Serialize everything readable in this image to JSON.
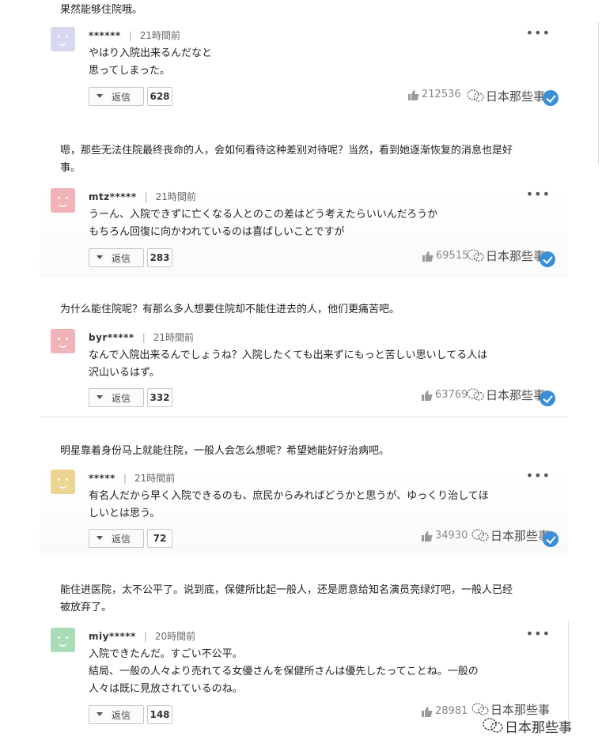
{
  "top_caption": "果然能够住院哦。",
  "watermark": "日本那些事",
  "reply_label": "返信",
  "comments": [
    {
      "caption": "",
      "user": "******",
      "time": "21時間前",
      "avatar_color": "#d6d9ef",
      "lines": [
        "やはり入院出来るんだなと",
        "思ってしまった。"
      ],
      "reply_count": "628",
      "likes": "212536"
    },
    {
      "caption_lines": [
        "嗯，那些无法住院最终丧命的人，会如何看待这种差别对待呢？当然，看到她逐渐恢复的消息也是好",
        "事。"
      ],
      "user": "mtz*****",
      "time": "21時間前",
      "avatar_color": "#f2b3b8",
      "lines": [
        "うーん、入院できずに亡くなる人とのこの差はどう考えたらいいんだろうか",
        "もちろん回復に向かわれているのは喜ばしいことですが"
      ],
      "reply_count": "283",
      "likes": "69515"
    },
    {
      "caption_lines": [
        "为什么能住院呢？有那么多人想要住院却不能住进去的人，他们更痛苦吧。"
      ],
      "user": "byr*****",
      "time": "21時間前",
      "avatar_color": "#f2b3b8",
      "lines": [
        "なんで入院出来るんでしょうね？入院したくても出来ずにもっと苦しい思いしてる人は",
        "沢山いるはず。"
      ],
      "reply_count": "332",
      "likes": "63769"
    },
    {
      "caption_lines": [
        "明星靠着身份马上就能住院，一般人会怎么想呢？希望她能好好治病吧。"
      ],
      "user": "*****",
      "time": "21時間前",
      "avatar_color": "#ecd592",
      "lines": [
        "有名人だから早く入院できるのも、庶民からみればどうかと思うが、ゆっくり治してほ",
        "しいとは思う。"
      ],
      "reply_count": "72",
      "likes": "34930"
    },
    {
      "caption_lines": [
        "能住进医院，太不公平了。说到底，保健所比起一般人，还是愿意给知名演员亮绿灯吧，一般人已经",
        "被放弃了。"
      ],
      "user": "miy*****",
      "time": "20時間前",
      "avatar_color": "#a9dcb7",
      "lines": [
        "入院できたんだ。すごい不公平。",
        "結局、一般の人々より売れてる女優さんを保健所さんは優先したってことね。一般の",
        "人々は既に見放されているのね。"
      ],
      "reply_count": "148",
      "likes": "28981"
    }
  ]
}
